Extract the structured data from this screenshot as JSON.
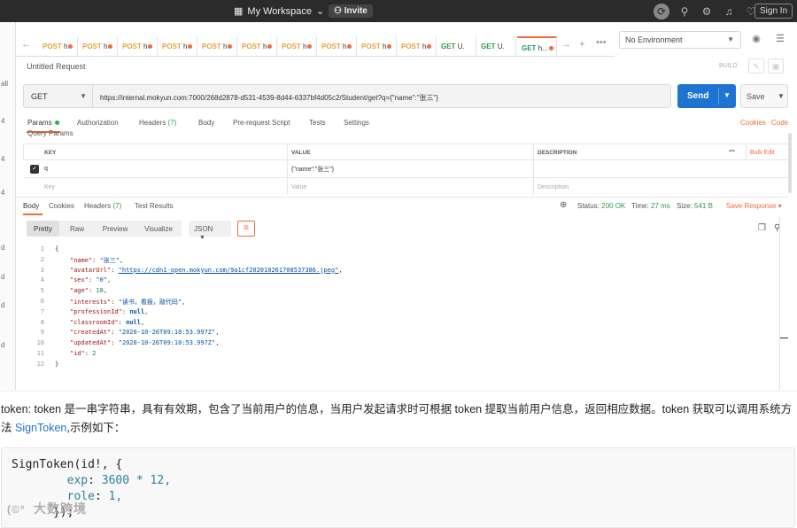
{
  "topbar": {
    "workspace": "My Workspace",
    "invite": "Invite",
    "signin": "Sign In"
  },
  "tabs": [
    {
      "method": "POST",
      "name": "h",
      "dot": true
    },
    {
      "method": "POST",
      "name": "h",
      "dot": true
    },
    {
      "method": "POST",
      "name": "h",
      "dot": true
    },
    {
      "method": "POST",
      "name": "h",
      "dot": true
    },
    {
      "method": "POST",
      "name": "h",
      "dot": true
    },
    {
      "method": "POST",
      "name": "h",
      "dot": true
    },
    {
      "method": "POST",
      "name": "h",
      "dot": true
    },
    {
      "method": "POST",
      "name": "h",
      "dot": true
    },
    {
      "method": "POST",
      "name": "h",
      "dot": true
    },
    {
      "method": "POST",
      "name": "h",
      "dot": true
    },
    {
      "method": "GET",
      "name": "U.",
      "dot": false
    },
    {
      "method": "GET",
      "name": "U.",
      "dot": false
    },
    {
      "method": "GET",
      "name": "h...",
      "dot": true
    }
  ],
  "environment": "No Environment",
  "request": {
    "title": "Untitled Request",
    "build": "BUILD",
    "method": "GET",
    "url": "https://internal.mokyun.com:7000/268d2878-d531-4539-8d44-6337bf4d05c2/Student/get?q={\"name\":\"张三\"}",
    "send": "Send",
    "save": "Save"
  },
  "req_tabs": {
    "params": "Params",
    "authorization": "Authorization",
    "headers": "Headers",
    "headers_count": "(7)",
    "body": "Body",
    "prerequest": "Pre-request Script",
    "tests": "Tests",
    "settings": "Settings",
    "cookies": "Cookies",
    "code": "Code"
  },
  "query_params_label": "Query Params",
  "params_table": {
    "headers": [
      "KEY",
      "VALUE",
      "DESCRIPTION"
    ],
    "bulk_edit": "Bulk Edit",
    "row": {
      "key": "q",
      "value": "{\"name\":\"张三\"}",
      "description": ""
    },
    "placeholders": {
      "key": "Key",
      "value": "Value",
      "description": "Description"
    }
  },
  "response": {
    "tabs": {
      "body": "Body",
      "cookies": "Cookies",
      "headers": "Headers",
      "headers_count": "(7)",
      "test_results": "Test Results"
    },
    "status_label": "Status:",
    "status_value": "200 OK",
    "time_label": "Time:",
    "time_value": "27 ms",
    "size_label": "Size:",
    "size_value": "541 B",
    "save_response": "Save Response",
    "views": [
      "Pretty",
      "Raw",
      "Preview",
      "Visualize"
    ],
    "format": "JSON"
  },
  "code_lines": [
    {
      "n": "1",
      "t": "{"
    },
    {
      "n": "2",
      "k": "\"name\"",
      "v": "\"张三\"",
      "vt": "s"
    },
    {
      "n": "3",
      "k": "\"avatarUrl\"",
      "v": "\"https://cdn1-open.mokyun.com/9a1cf202010261708537386.jpeg\"",
      "vt": "link"
    },
    {
      "n": "4",
      "k": "\"sex\"",
      "v": "\"0\"",
      "vt": "s"
    },
    {
      "n": "5",
      "k": "\"age\"",
      "v": "18",
      "vt": "nm"
    },
    {
      "n": "6",
      "k": "\"interests\"",
      "v": "\"读书，看报，敲代码\"",
      "vt": "s"
    },
    {
      "n": "7",
      "k": "\"professionId\"",
      "v": "null",
      "vt": "nl"
    },
    {
      "n": "8",
      "k": "\"classroomId\"",
      "v": "null",
      "vt": "nl"
    },
    {
      "n": "9",
      "k": "\"createdAt\"",
      "v": "\"2020-10-26T09:10:53.997Z\"",
      "vt": "s"
    },
    {
      "n": "10",
      "k": "\"updatedAt\"",
      "v": "\"2020-10-26T09:10:53.997Z\"",
      "vt": "s"
    },
    {
      "n": "11",
      "k": "\"id\"",
      "v": "2",
      "vt": "nm",
      "last": true
    },
    {
      "n": "12",
      "t": "}"
    }
  ],
  "doc": {
    "para_before": "token: token 是一串字符串，具有有效期，包含了当前用户的信息，当用户发起请求时可根据 token 提取当前用户信息，返回相应数据。token 获取可以调用系统方法 ",
    "para_link": "SignToken",
    "para_after": ",示例如下：",
    "code1": "SignToken(id!, {",
    "code2_key": "exp",
    "code2_val": "3600 * 12,",
    "code3_key": "role",
    "code3_val": "1,",
    "code4": "});",
    "watermark": "大数跨境"
  }
}
